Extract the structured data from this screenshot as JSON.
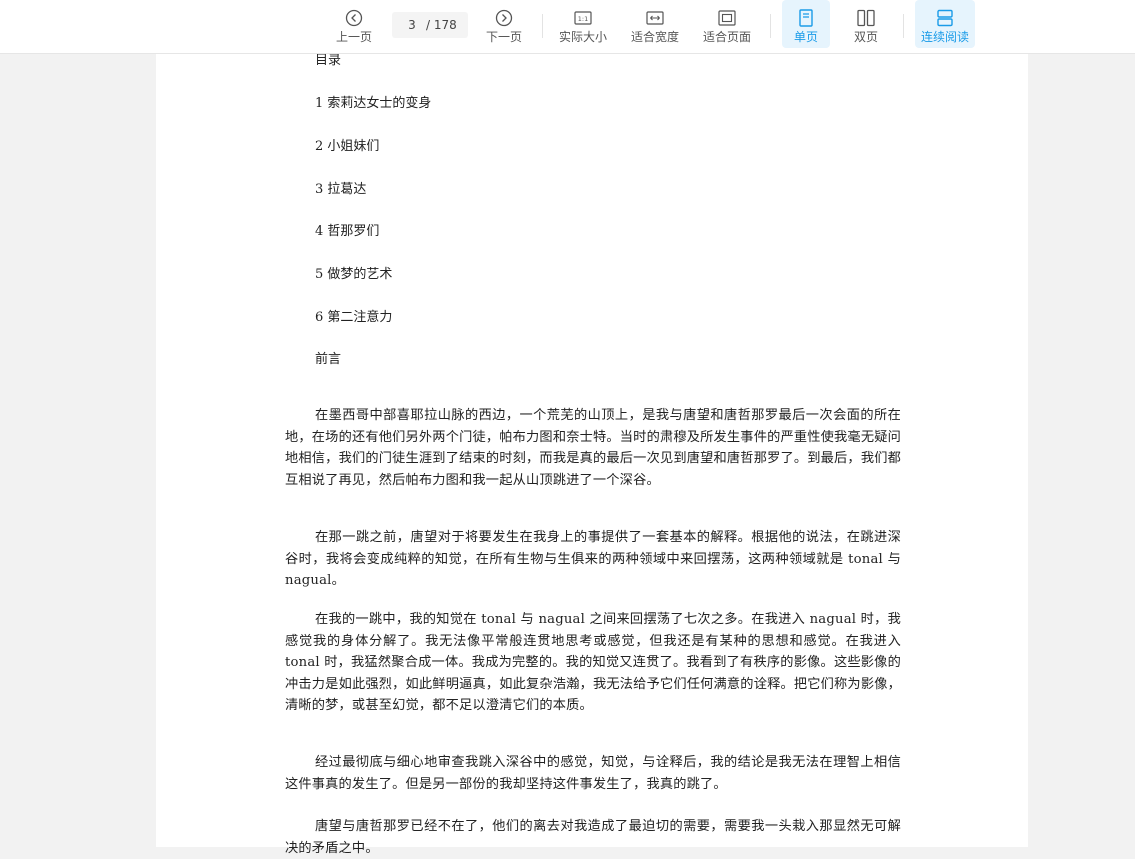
{
  "toolbar": {
    "prev_label": "上一页",
    "next_label": "下一页",
    "current_page": "3",
    "total_pages": "/ 178",
    "actual_size_label": "实际大小",
    "fit_width_label": "适合宽度",
    "fit_page_label": "适合页面",
    "single_label": "单页",
    "double_label": "双页",
    "continuous_label": "连续阅读",
    "accent_color": "#1a9be8"
  },
  "document": {
    "toc": [
      "目录",
      "1 索莉达女士的变身",
      "2 小姐妹们",
      "3 拉葛达",
      "4 哲那罗们",
      "5 做梦的艺术",
      "6 第二注意力",
      "前言"
    ],
    "paragraphs": [
      "在墨西哥中部喜耶拉山脉的西边，一个荒芜的山顶上，是我与唐望和唐哲那罗最后一次会面的所在地，在场的还有他们另外两个门徒，帕布力图和奈士特。当时的肃穆及所发生事件的严重性使我毫无疑问地相信，我们的门徒生涯到了结束的时刻，而我是真的最后一次见到唐望和唐哲那罗了。到最后，我们都互相说了再见，然后帕布力图和我一起从山顶跳进了一个深谷。",
      "在那一跳之前，唐望对于将要发生在我身上的事提供了一套基本的解释。根据他的说法，在跳进深谷时，我将会变成纯粹的知觉，在所有生物与生俱来的两种领域中来回摆荡，这两种领域就是 tonal 与 nagual。",
      "在我的一跳中，我的知觉在 tonal 与 nagual 之间来回摆荡了七次之多。在我进入 nagual 时，我感觉我的身体分解了。我无法像平常般连贯地思考或感觉，但我还是有某种的思想和感觉。在我进入 tonal 时，我猛然聚合成一体。我成为完整的。我的知觉又连贯了。我看到了有秩序的影像。这些影像的冲击力是如此强烈，如此鲜明逼真，如此复杂浩瀚，我无法给予它们任何满意的诠释。把它们称为影像，清晰的梦，或甚至幻觉，都不足以澄清它们的本质。",
      "经过最彻底与细心地审查我跳入深谷中的感觉，知觉，与诠释后，我的结论是我无法在理智上相信这件事真的发生了。但是另一部份的我却坚持这件事发生了，我真的跳了。",
      "唐望与唐哲那罗已经不在了，他们的离去对我造成了最迫切的需要，需要我一头栽入那显然无可解决的矛盾之中。"
    ]
  }
}
